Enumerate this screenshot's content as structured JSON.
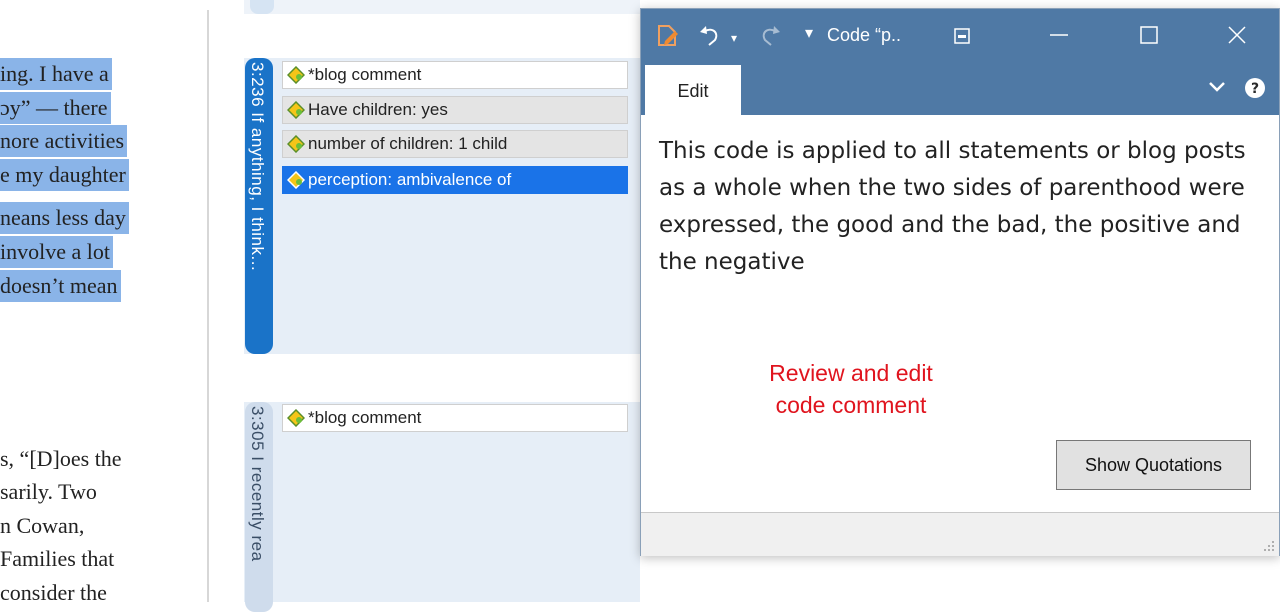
{
  "document": {
    "highlighted_lines": [
      "ing. I have a",
      "ɔy” — there",
      "nore activities",
      "e my daughter",
      "neans less day",
      " involve a lot",
      " doesn’t mean"
    ],
    "plain_lines": [
      "s, “[D]oes the",
      " sarily. Two",
      " n Cowan,",
      "Families that",
      " consider the"
    ]
  },
  "margin": {
    "quotations": [
      {
        "label": "3:236 If anything, I think...",
        "codes": [
          {
            "label": "*blog comment",
            "style": "white"
          },
          {
            "label": "Have children: yes",
            "style": "grey"
          },
          {
            "label": "number of children: 1 child",
            "style": "grey"
          },
          {
            "label": "perception: ambivalence of",
            "style": "selected"
          }
        ]
      },
      {
        "label": "3:305 I recently rea",
        "codes": [
          {
            "label": "*blog comment",
            "style": "white"
          }
        ]
      }
    ]
  },
  "window": {
    "title": "Code “p..",
    "tab_label": "Edit",
    "comment_text": "This code is applied to all statements or blog posts as a whole when the two sides of parenthood were expressed, the good and the bad, the positive and the negative",
    "annotation_line1": "Review and edit",
    "annotation_line2": "code comment",
    "show_quotations_label": "Show Quotations"
  },
  "colors": {
    "titlebar": "#4f79a5",
    "highlight": "#8ab4e8",
    "selected": "#1a73e8",
    "annotation": "#e0141e"
  },
  "icons": [
    "edit-code-icon",
    "undo-icon",
    "redo-icon",
    "dropdown-icon",
    "pin-icon",
    "minimize-icon",
    "maximize-icon",
    "close-icon",
    "chevron-down-icon",
    "help-icon",
    "code-icon"
  ]
}
